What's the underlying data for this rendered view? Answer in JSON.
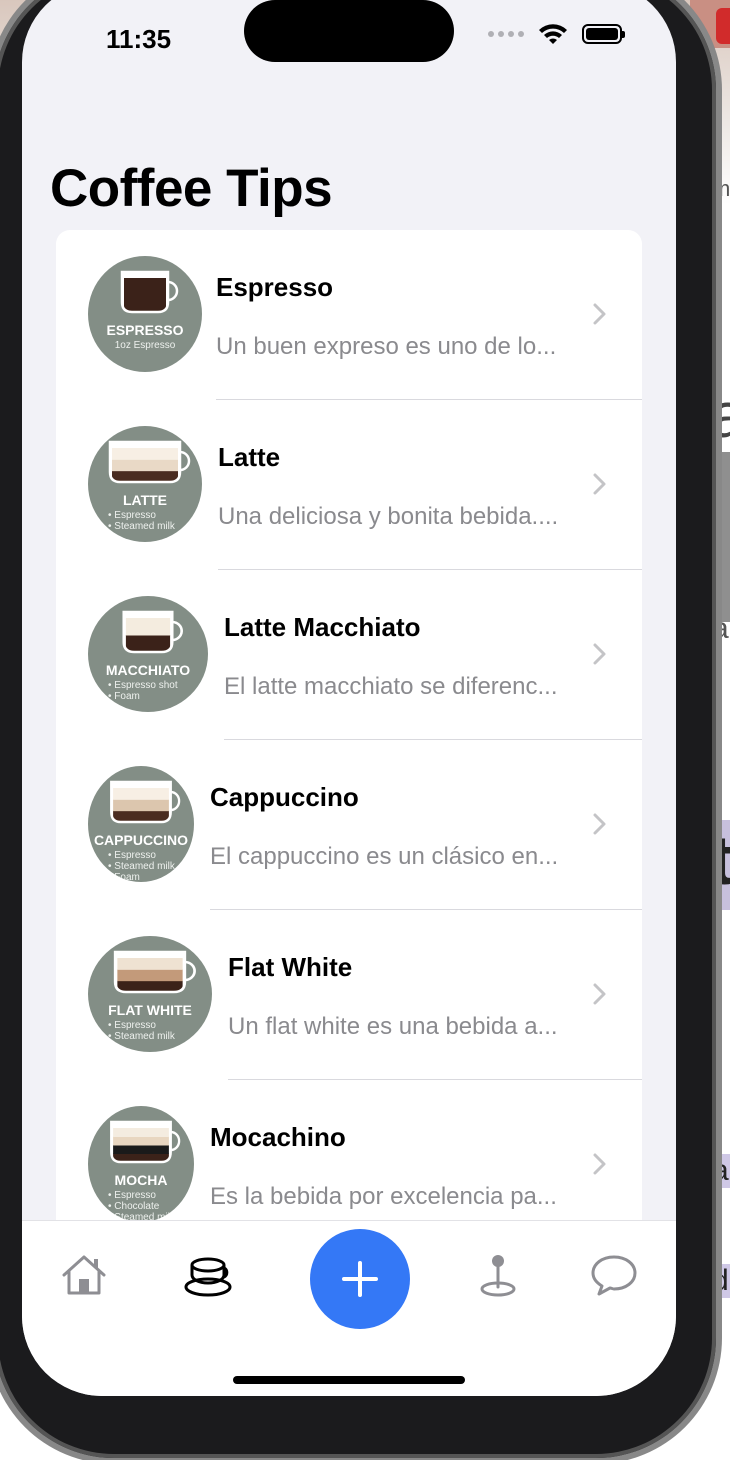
{
  "status_bar": {
    "time": "11:35"
  },
  "header": {
    "title": "Coffee Tips"
  },
  "items": [
    {
      "title": "Espresso",
      "subtitle": "Un buen expreso es uno de lo...",
      "thumb": {
        "label": "ESPRESSO",
        "lines": [
          "1oz Espresso"
        ]
      }
    },
    {
      "title": "Latte",
      "subtitle": "Una deliciosa y bonita bebida....",
      "thumb": {
        "label": "LATTE",
        "lines": [
          "• Espresso",
          "• Steamed milk"
        ]
      }
    },
    {
      "title": "Latte Macchiato",
      "subtitle": "El latte macchiato se diferenc...",
      "thumb": {
        "label": "MACCHIATO",
        "lines": [
          "• Espresso shot",
          "• Foam"
        ]
      }
    },
    {
      "title": "Cappuccino",
      "subtitle": "El cappuccino es un clásico en...",
      "thumb": {
        "label": "CAPPUCCINO",
        "lines": [
          "• Espresso",
          "• Steamed milk",
          "• Foam"
        ]
      }
    },
    {
      "title": "Flat White",
      "subtitle": "Un flat white es una bebida a...",
      "thumb": {
        "label": "FLAT WHITE",
        "lines": [
          "• Espresso",
          "• Steamed milk"
        ]
      }
    },
    {
      "title": "Mocachino",
      "subtitle": "Es la bebida por excelencia pa...",
      "thumb": {
        "label": "MOCHA",
        "lines": [
          "• Espresso",
          "• Chocolate",
          "• Steamed milk"
        ]
      }
    }
  ],
  "tab_bar": {
    "tabs": [
      {
        "icon": "house-icon",
        "selected": false
      },
      {
        "icon": "coffee-cup-icon",
        "selected": true
      },
      {
        "icon": "plus-icon",
        "selected": false
      },
      {
        "icon": "map-pin-icon",
        "selected": false
      },
      {
        "icon": "chat-bubble-icon",
        "selected": false
      }
    ]
  },
  "colors": {
    "accent": "#3478f6",
    "thumb_bg": "#838e86",
    "background": "#f2f2f7"
  }
}
